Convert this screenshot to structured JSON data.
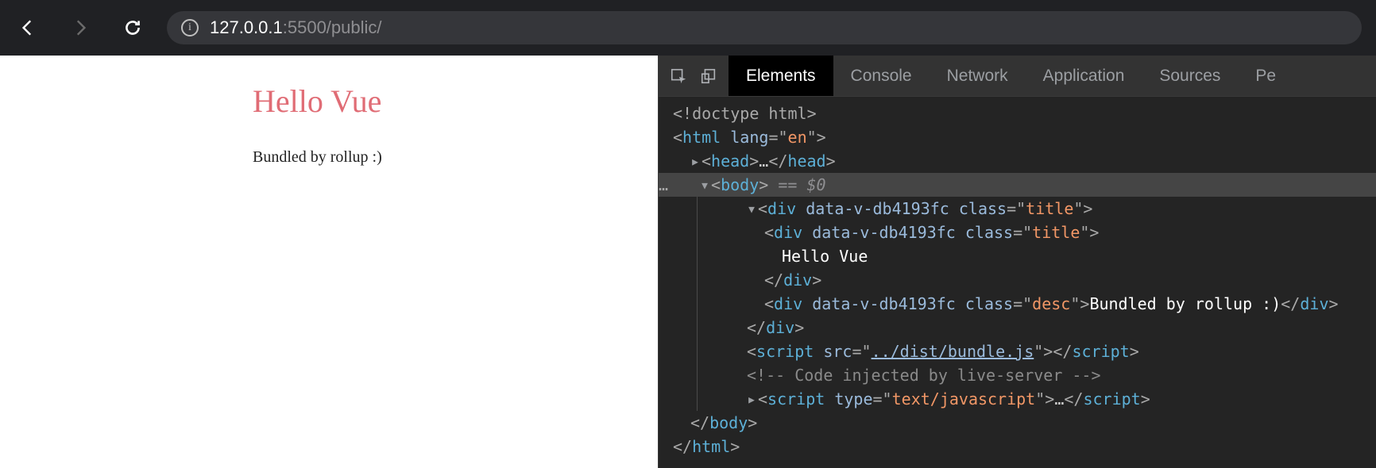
{
  "url": {
    "host": "127.0.0.1",
    "port_path": ":5500/public/"
  },
  "page": {
    "title": "Hello Vue",
    "desc": "Bundled by rollup :)"
  },
  "devtools": {
    "tabs": [
      "Elements",
      "Console",
      "Network",
      "Application",
      "Sources",
      "Pe"
    ],
    "active_tab": "Elements",
    "tree": {
      "line1": "<!doctype html>",
      "line2_open": "<",
      "line2_tag": "html",
      "line2_attr": " lang",
      "line2_eq": "=\"",
      "line2_val": "en",
      "line2_close": "\">",
      "line3_head_open": "<",
      "line3_head_tag": "head",
      "line3_head_mid": ">",
      "line3_head_ell": "…",
      "line3_head_close1": "</",
      "line3_head_close2": "head",
      "line3_head_close3": ">",
      "line4_body_open": "<",
      "line4_body_tag": "body",
      "line4_body_close": ">",
      "line4_eq": " == ",
      "line4_sel": "$0",
      "line5_open": "<",
      "line5_tag": "div",
      "line5_attr1": " data-v-db4193fc",
      "line5_attr2": " class",
      "line5_eq": "=\"",
      "line5_val": "title",
      "line5_close": "\">",
      "line6_open": "<",
      "line6_tag": "div",
      "line6_attr1": " data-v-db4193fc",
      "line6_attr2": " class",
      "line6_eq": "=\"",
      "line6_val": "title",
      "line6_close": "\">",
      "line7_text": "Hello Vue",
      "line8_close1": "</",
      "line8_tag": "div",
      "line8_close2": ">",
      "line9_open": "<",
      "line9_tag": "div",
      "line9_attr1": " data-v-db4193fc",
      "line9_attr2": " class",
      "line9_eq": "=\"",
      "line9_val": "desc",
      "line9_close": "\">",
      "line9_text": "Bundled by rollup :)",
      "line9_end1": "</",
      "line9_endtag": "div",
      "line9_end2": ">",
      "line10_close1": "</",
      "line10_tag": "div",
      "line10_close2": ">",
      "line11_open": "<",
      "line11_tag": "script",
      "line11_attr": " src",
      "line11_eq": "=\"",
      "line11_val": "../dist/bundle.js",
      "line11_close": "\">",
      "line11_end1": "</",
      "line11_endtag": "script",
      "line11_end2": ">",
      "line12_comment": "<!-- Code injected by live-server -->",
      "line13_open": "<",
      "line13_tag": "script",
      "line13_attr": " type",
      "line13_eq": "=\"",
      "line13_val": "text/javascript",
      "line13_close": "\">",
      "line13_ell": "…",
      "line13_end1": "</",
      "line13_endtag": "script",
      "line13_end2": ">",
      "line14_close1": "</",
      "line14_tag": "body",
      "line14_close2": ">",
      "line15_close1": "</",
      "line15_tag": "html",
      "line15_close2": ">"
    }
  }
}
